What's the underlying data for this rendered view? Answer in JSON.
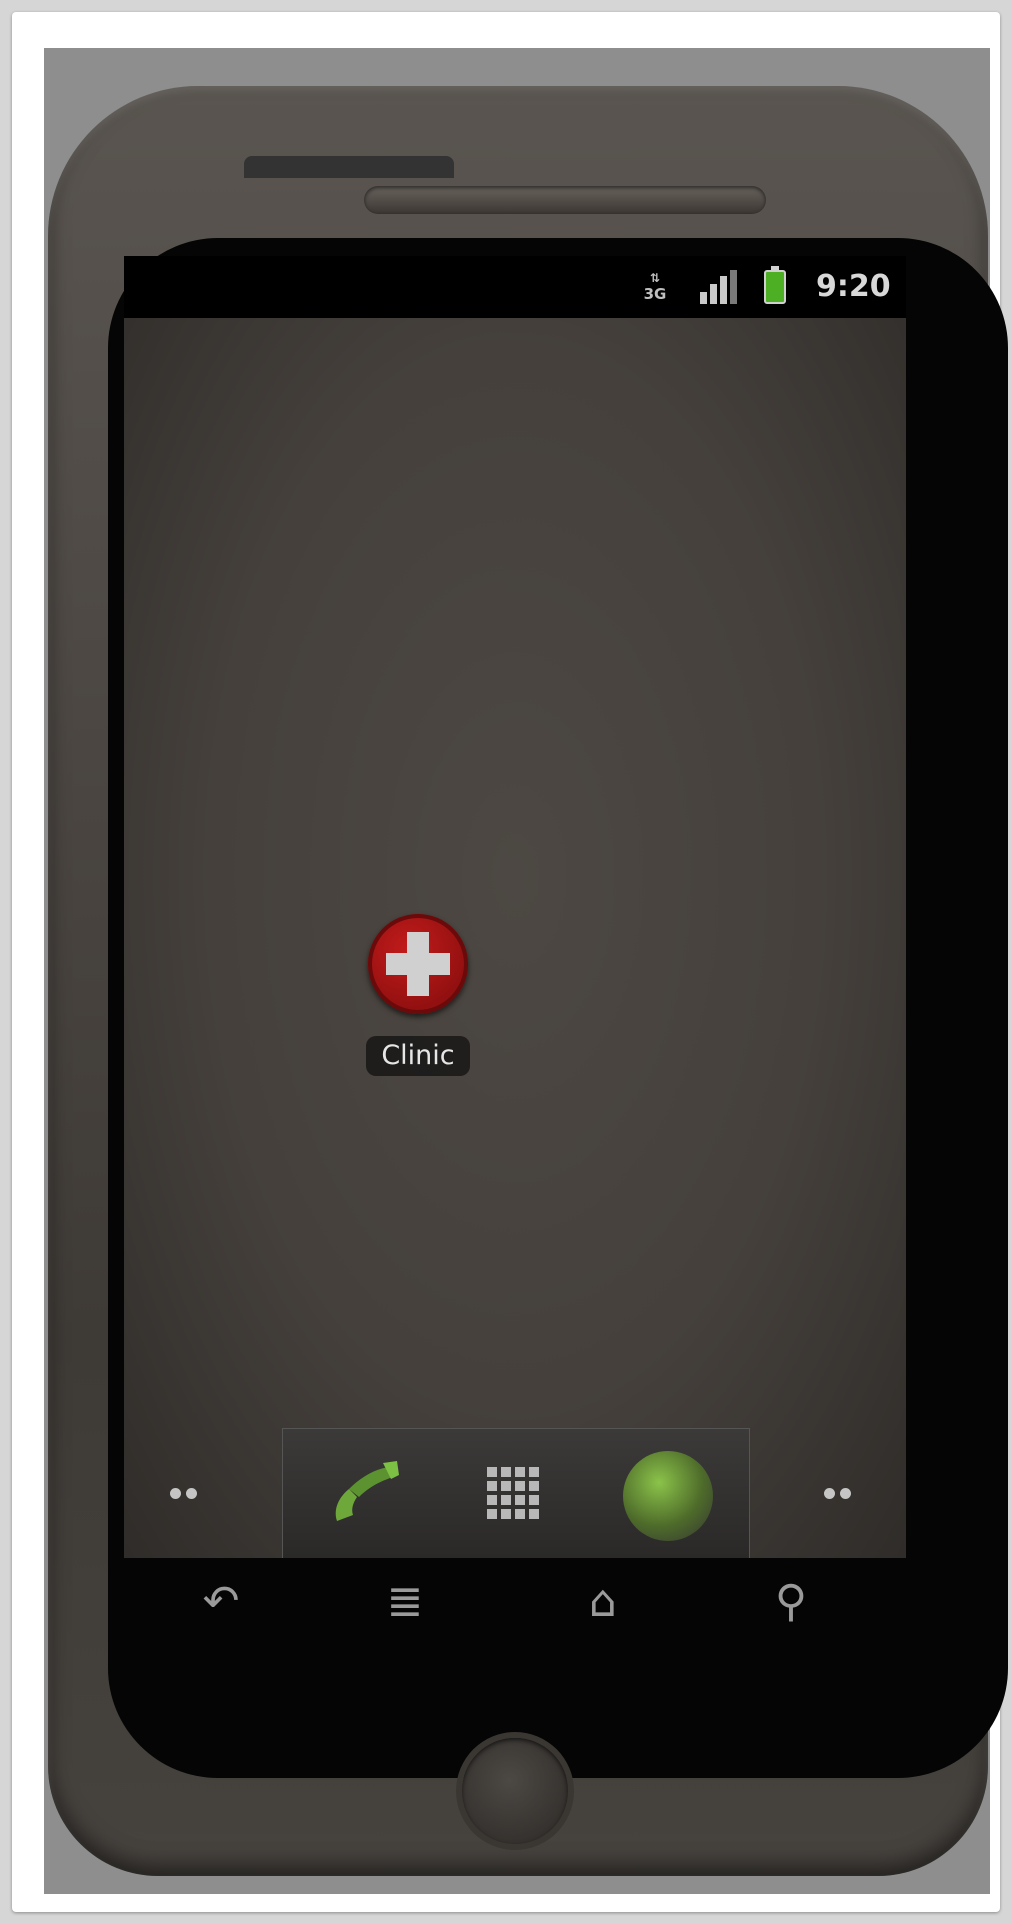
{
  "status_bar": {
    "network_type": "3G",
    "signal_icon": "signal-bars-icon",
    "battery_icon": "battery-charging-icon",
    "battery_color": "#4caf24",
    "time": "9:20"
  },
  "home_screen": {
    "apps": [
      {
        "label": "Clinic",
        "icon": "red-cross-icon",
        "icon_color": "#b01515"
      }
    ],
    "page_indicators": {
      "left": "••",
      "right": "••"
    }
  },
  "dock": {
    "items": [
      {
        "name": "phone",
        "icon": "phone-handset-icon"
      },
      {
        "name": "launcher",
        "icon": "app-grid-icon"
      },
      {
        "name": "browser",
        "icon": "globe-icon"
      }
    ]
  },
  "nav_keys": {
    "back": "↶",
    "menu": "≣",
    "home": "⌂",
    "search": "⚲"
  }
}
